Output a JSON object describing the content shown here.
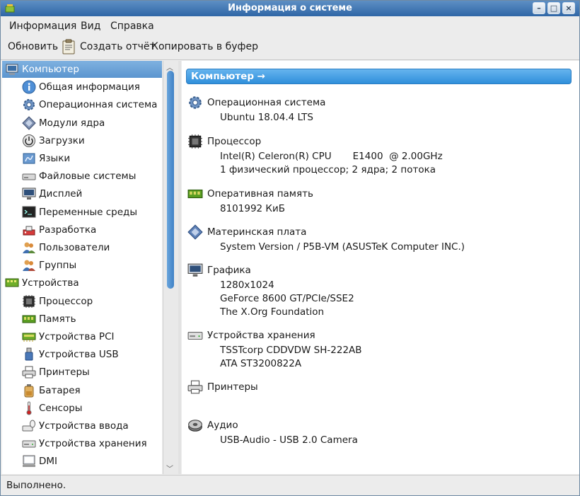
{
  "window": {
    "title": "Информация о системе"
  },
  "menu": [
    {
      "label": "Информация"
    },
    {
      "label": "Вид"
    },
    {
      "label": "Справка"
    }
  ],
  "toolbar": {
    "refresh": "Обновить",
    "report": "Создать отчёт",
    "copy": "Копировать в буфер"
  },
  "sidebar": {
    "items": [
      {
        "label": "Компьютер",
        "icon": "computer-icon",
        "level": 0,
        "selected": true
      },
      {
        "label": "Общая информация",
        "icon": "info-icon",
        "level": 1
      },
      {
        "label": "Операционная система",
        "icon": "gear-icon",
        "level": 1
      },
      {
        "label": "Модули ядра",
        "icon": "module-icon",
        "level": 1
      },
      {
        "label": "Загрузки",
        "icon": "power-icon",
        "level": 1
      },
      {
        "label": "Языки",
        "icon": "language-icon",
        "level": 1
      },
      {
        "label": "Файловые системы",
        "icon": "drive-icon",
        "level": 1
      },
      {
        "label": "Дисплей",
        "icon": "monitor-icon",
        "level": 1
      },
      {
        "label": "Переменные среды",
        "icon": "terminal-icon",
        "level": 1
      },
      {
        "label": "Разработка",
        "icon": "development-icon",
        "level": 1
      },
      {
        "label": "Пользователи",
        "icon": "users-icon",
        "level": 1
      },
      {
        "label": "Группы",
        "icon": "group-icon",
        "level": 1
      },
      {
        "label": "Устройства",
        "icon": "devices-icon",
        "level": 0
      },
      {
        "label": "Процессор",
        "icon": "cpu-icon",
        "level": 1
      },
      {
        "label": "Память",
        "icon": "memory-icon",
        "level": 1
      },
      {
        "label": "Устройства PCI",
        "icon": "pci-icon",
        "level": 1
      },
      {
        "label": "Устройства USB",
        "icon": "usb-icon",
        "level": 1
      },
      {
        "label": "Принтеры",
        "icon": "printer-icon",
        "level": 1
      },
      {
        "label": "Батарея",
        "icon": "battery-icon",
        "level": 1
      },
      {
        "label": "Сенсоры",
        "icon": "thermometer-icon",
        "level": 1
      },
      {
        "label": "Устройства ввода",
        "icon": "input-devices-icon",
        "level": 1
      },
      {
        "label": "Устройства хранения",
        "icon": "storage-icon",
        "level": 1
      },
      {
        "label": "DMI",
        "icon": "dmi-icon",
        "level": 1
      }
    ]
  },
  "main": {
    "header": "Компьютер →",
    "sections": [
      {
        "title": "Операционная система",
        "icon": "gear-icon",
        "lines": [
          "Ubuntu 18.04.4 LTS"
        ]
      },
      {
        "title": "Процессор",
        "icon": "cpu-icon",
        "lines": [
          "Intel(R) Celeron(R) CPU       E1400  @ 2.00GHz",
          "1 физический процессор; 2 ядра; 2 потока"
        ]
      },
      {
        "title": "Оперативная память",
        "icon": "memory-icon",
        "lines": [
          "8101992 КиБ"
        ]
      },
      {
        "title": "Материнская плата",
        "icon": "motherboard-icon",
        "lines": [
          "System Version / P5B-VM (ASUSTeK Computer INC.)"
        ]
      },
      {
        "title": "Графика",
        "icon": "monitor-icon",
        "lines": [
          "1280x1024",
          "GeForce 8600 GT/PCIe/SSE2",
          "The X.Org Foundation"
        ]
      },
      {
        "title": "Устройства хранения",
        "icon": "storage-icon",
        "lines": [
          "TSSTcorp CDDVDW SH-222AB",
          "ATA ST3200822A"
        ]
      },
      {
        "title": "Принтеры",
        "icon": "printer-icon",
        "lines": []
      },
      {
        "title": "Аудио",
        "icon": "audio-icon",
        "lines": [
          "USB-Audio - USB 2.0 Camera"
        ]
      }
    ]
  },
  "status": {
    "text": "Выполнено."
  },
  "colors": {
    "accent": "#3f8fd8",
    "titlebar": "#3a71ae",
    "selection": "#6ba3d9"
  }
}
